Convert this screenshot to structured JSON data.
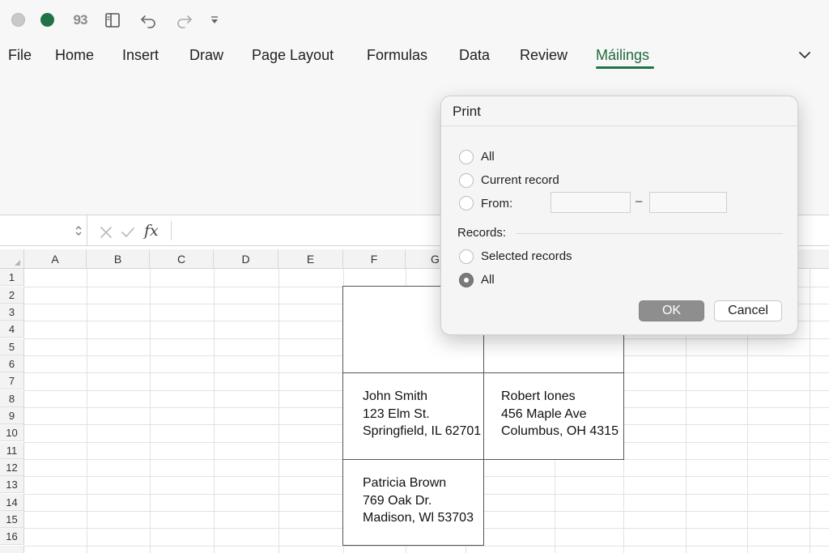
{
  "ribbon": {
    "tabs": [
      "File",
      "Home",
      "Insert",
      "Draw",
      "Page Layout",
      "Formulas",
      "Data",
      "Review",
      "Máilings"
    ],
    "active_tab": "Máilings"
  },
  "titlebar": {
    "quick_number": "93"
  },
  "formula_bar": {
    "fx_label": "fx",
    "value": ""
  },
  "grid": {
    "columns": [
      "A",
      "B",
      "C",
      "D",
      "E",
      "F",
      "G"
    ],
    "rows": [
      "1",
      "2",
      "3",
      "4",
      "5",
      "6",
      "7",
      "8",
      "9",
      "10",
      "11",
      "12",
      "13",
      "14",
      "15",
      "16"
    ]
  },
  "labels": [
    {
      "name": "John Smith",
      "street": "123 Elm St.",
      "city": "Springfield, IL 62701"
    },
    {
      "name": "Robert Iones",
      "street": "456 Maple Ave",
      "city": "Columbus, OH 4315"
    },
    {
      "name": "Patricia Brown",
      "street": "769 Oak Dr.",
      "city": "Madison, Wl 53703"
    }
  ],
  "dialog": {
    "title": "Print",
    "options": {
      "all": "All",
      "current_record": "Current record",
      "from": "From:"
    },
    "from_value": "",
    "to_value": "",
    "range_dash": "–",
    "records_label": "Records:",
    "records_options": {
      "selected": "Selected records",
      "all": "All"
    },
    "selected_records_option": "All",
    "ok_label": "OK",
    "cancel_label": "Cancel"
  },
  "colors": {
    "accent": "#217346",
    "active_tab_text": "#1e6b3e"
  },
  "icons": [
    "circle-icon",
    "sidebar-layout-icon",
    "undo-icon",
    "redo-icon",
    "customize-toolbar-icon",
    "chevron-down-icon",
    "cancel-x-icon",
    "enter-check-icon"
  ]
}
